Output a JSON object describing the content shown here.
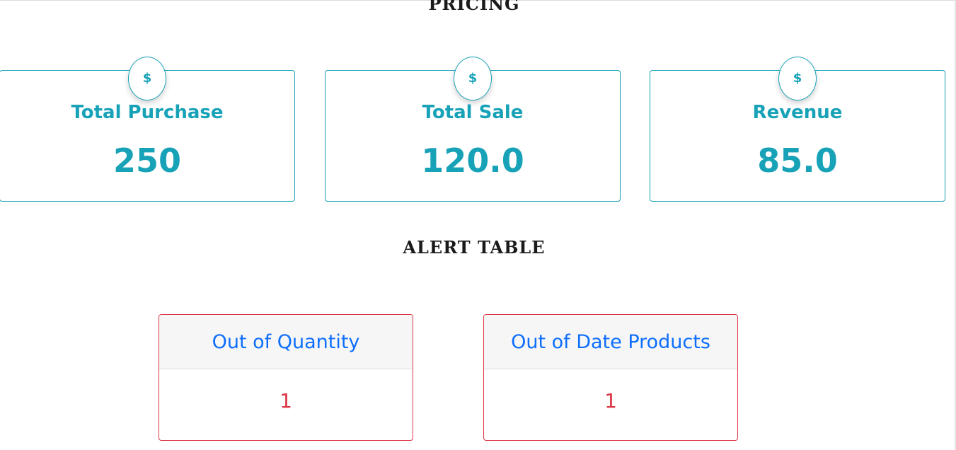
{
  "sections": {
    "pricing_title": "PRICING",
    "alert_title": "ALERT TABLE"
  },
  "stats": [
    {
      "icon": "dollar-icon",
      "symbol": "$",
      "label": "Total Purchase",
      "value": "250"
    },
    {
      "icon": "dollar-icon",
      "symbol": "$",
      "label": "Total Sale",
      "value": "120.0"
    },
    {
      "icon": "dollar-icon",
      "symbol": "$",
      "label": "Revenue",
      "value": "85.0"
    }
  ],
  "alerts": [
    {
      "label": "Out of Quantity",
      "value": "1"
    },
    {
      "label": "Out of Date Products",
      "value": "1"
    }
  ],
  "colors": {
    "accent": "#17a2b8",
    "link": "#0d6efd",
    "danger": "#dc3545"
  }
}
